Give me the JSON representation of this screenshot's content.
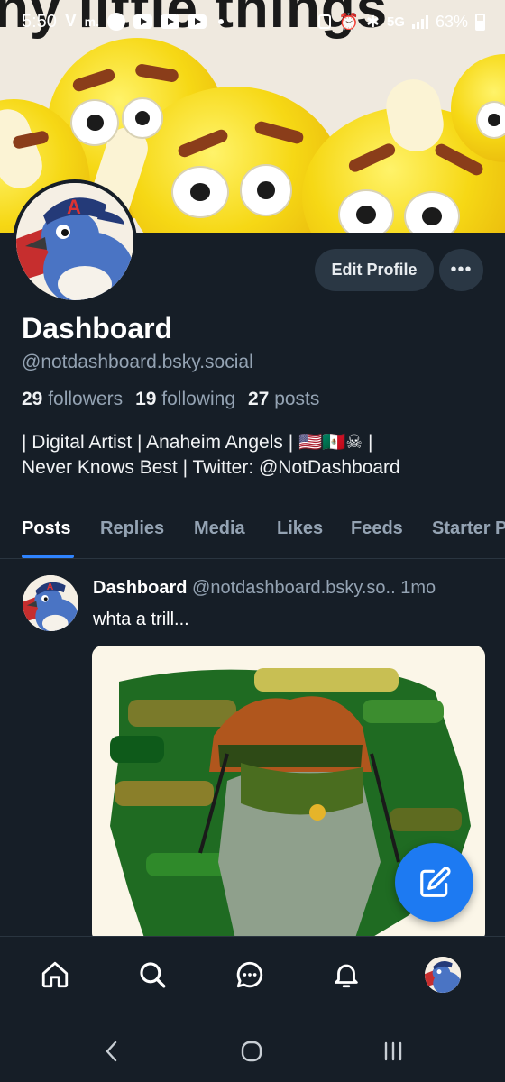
{
  "status_bar": {
    "time": "5:50",
    "left_glyphs": [
      "V",
      "m."
    ],
    "network": "5G",
    "battery": "63%"
  },
  "banner": {
    "text": "ny little things"
  },
  "profile": {
    "edit_label": "Edit Profile",
    "more_label": "•••",
    "display_name": "Dashboard",
    "handle": "@notdashboard.bsky.social",
    "stats": {
      "followers_count": "29",
      "followers_label": "followers",
      "following_count": "19",
      "following_label": "following",
      "posts_count": "27",
      "posts_label": "posts"
    },
    "bio_line1": "| Digital Artist | Anaheim Angels | 🇺🇸🇲🇽☠ |",
    "bio_line2": "Never Knows Best | Twitter: @NotDashboard"
  },
  "tabs": [
    "Posts",
    "Replies",
    "Media",
    "Likes",
    "Feeds",
    "Starter Packs"
  ],
  "post": {
    "author": "Dashboard",
    "handle": "@notdashboard.bsky.so..",
    "time": "1mo",
    "text": "whta a trill..."
  },
  "icons": {
    "compose": "compose-icon",
    "nav": [
      "home-icon",
      "search-icon",
      "chat-icon",
      "bell-icon",
      "profile-avatar"
    ],
    "system": [
      "back-icon",
      "home-circle-icon",
      "recents-icon"
    ]
  },
  "colors": {
    "background": "#161e27",
    "accent": "#1d7af2",
    "muted": "#94a3b3"
  }
}
